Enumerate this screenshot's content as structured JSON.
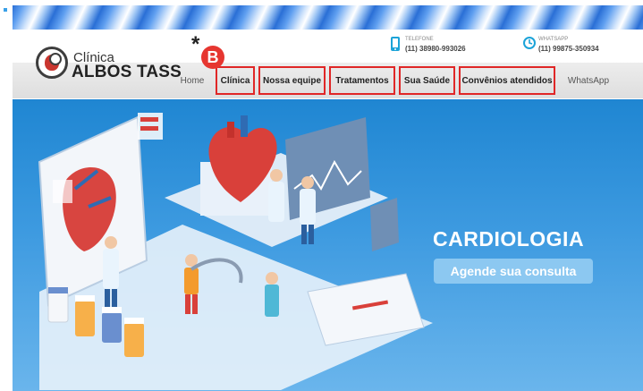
{
  "brand": {
    "prefix": "Clínica",
    "name": "ALBOS TASS"
  },
  "contacts": [
    {
      "label": "TELEFONE",
      "number": "(11) 38980-993026",
      "icon": "phone-icon"
    },
    {
      "label": "WHATSAPP",
      "number": "(11) 99875-350934",
      "icon": "clock-icon"
    }
  ],
  "nav": {
    "items": [
      {
        "label": "Home",
        "highlighted": false
      },
      {
        "label": "Clínica",
        "highlighted": true
      },
      {
        "label": "Nossa equipe",
        "highlighted": true
      },
      {
        "label": "Tratamentos",
        "highlighted": true
      },
      {
        "label": "Sua Saúde",
        "highlighted": true
      },
      {
        "label": "Convênios atendidos",
        "highlighted": true
      },
      {
        "label": "WhatsApp",
        "highlighted": false
      }
    ]
  },
  "annotation": {
    "asterisk": "*",
    "badge": "B"
  },
  "hero": {
    "title": "CARDIOLOGIA",
    "cta": "Agende sua consulta"
  },
  "colors": {
    "accent_red": "#e02727",
    "hero_blue": "#1f86d2",
    "contact_icon": "#1ba3d8"
  }
}
